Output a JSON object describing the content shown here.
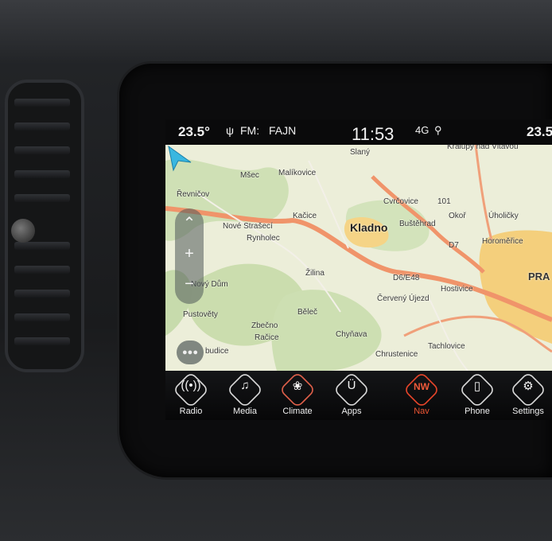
{
  "status_bar": {
    "temp_left": "23.5°",
    "radio_icon": "radio-signal-icon",
    "band": "FM:",
    "station": "FAJN",
    "time": "11:53",
    "network": "4G",
    "location_icon": "location-pin-icon",
    "temp_right": "23.5"
  },
  "map": {
    "places": {
      "slany": "Slaný",
      "kralupy": "Kralupy nad Vltavou",
      "revnicov": "Řevničov",
      "msec": "Mšec",
      "malikovice": "Malíkovice",
      "cvrcovice": "Cvrčovice",
      "r101": "101",
      "kacice": "Kačice",
      "kladno": "Kladno",
      "bustehrad": "Buštěhrad",
      "okor": "Okoř",
      "uholicky": "Úholičky",
      "nove_straseci": "Nové Strašecí",
      "rynholec": "Rynholec",
      "d7": "D7",
      "horomerice": "Horoměřice",
      "prague": "PRA",
      "zilina": "Žilina",
      "d6": "D6/E48",
      "novy_dum": "Nový Dům",
      "hostivice": "Hostivice",
      "cerveny_ujezd": "Červený Újezd",
      "pustovety": "Pustověty",
      "belec": "Běleč",
      "zbecno": "Zbečno",
      "racice": "Račice",
      "chynava": "Chyňava",
      "budice": "budice",
      "chrustenice": "Chrustenice",
      "tachlovice": "Tachlovice"
    },
    "colors": {
      "motorway": "#f0946a",
      "forest": "#c9ddb0",
      "urban": "#f6d27a",
      "accent_arrow": "#39b7e0"
    }
  },
  "controls": {
    "up_icon": "chevron-up-icon",
    "zoom_in": "+",
    "zoom_out": "−",
    "menu_icon": "menu-dots-icon"
  },
  "tabs": [
    {
      "label": "Radio",
      "icon": "radio-icon",
      "glyph": "📻"
    },
    {
      "label": "Media",
      "icon": "music-note-icon",
      "glyph": "♫"
    },
    {
      "label": "Climate",
      "icon": "climate-icon",
      "glyph": "✿"
    },
    {
      "label": "Apps",
      "icon": "apps-icon",
      "glyph": "U"
    },
    {
      "label": "Nav",
      "icon": "compass-icon",
      "glyph": "NW",
      "active": true
    },
    {
      "label": "Phone",
      "icon": "phone-icon",
      "glyph": "▯"
    },
    {
      "label": "Settings",
      "icon": "gear-icon",
      "glyph": "⚙"
    }
  ]
}
